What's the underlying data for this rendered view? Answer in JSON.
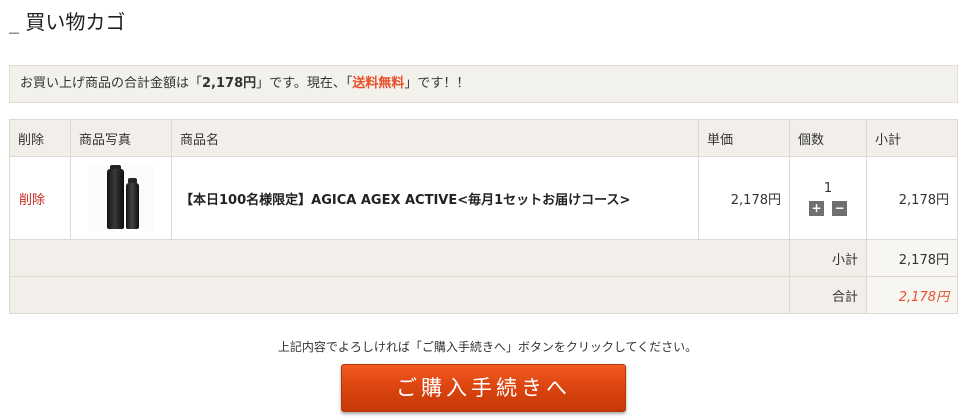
{
  "page": {
    "title": "_ 買い物カゴ"
  },
  "notice": {
    "prefix": "お買い上げ商品の合計金額は「",
    "amount": "2,178円",
    "middle": "」です。現在、「",
    "free_shipping": "送料無料",
    "suffix": "」です！！"
  },
  "cart": {
    "headers": {
      "delete": "削除",
      "photo": "商品写真",
      "name": "商品名",
      "unit_price": "単価",
      "quantity": "個数",
      "subtotal": "小計"
    },
    "items": [
      {
        "delete_label": "削除",
        "name": "【本日100名様限定】AGICA AGEX ACTIVE<毎月1セットお届けコース>",
        "unit_price": "2,178円",
        "quantity": "1",
        "plus_label": "+",
        "minus_label": "−",
        "subtotal": "2,178円"
      }
    ],
    "summary": {
      "subtotal_label": "小計",
      "subtotal_value": "2,178円",
      "total_label": "合計",
      "total_value": "2,178円"
    }
  },
  "footer": {
    "instruction": "上記内容でよろしければ「ご購入手続きへ」ボタンをクリックしてください。",
    "proceed_button": "ご購入手続きへ"
  },
  "colors": {
    "accent": "#e8502a",
    "delete_link": "#c8281f",
    "button": "#d8420d"
  }
}
